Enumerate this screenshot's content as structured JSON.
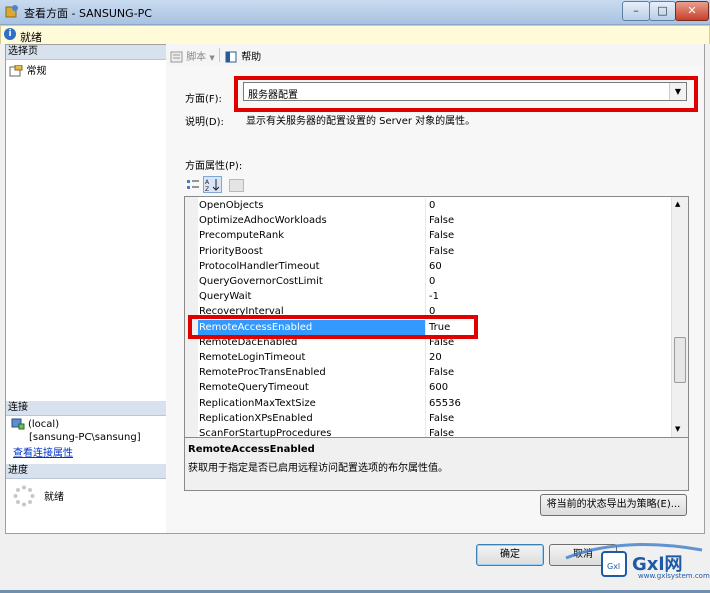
{
  "window": {
    "title": "查看方面 - SANSUNG-PC",
    "min_label": "–",
    "max_label": "□",
    "close_label": "✕"
  },
  "status": {
    "text": "就绪"
  },
  "left": {
    "select_page_label": "选择页",
    "pages": [
      {
        "label": "常规"
      }
    ],
    "connection_header": "连接",
    "server": "(local)",
    "user": "[sansung-PC\\sansung]",
    "view_conn_props": "查看连接属性",
    "progress_header": "进度",
    "progress_status": "就绪"
  },
  "toolbar": {
    "script_label": "脚本",
    "help_label": "帮助"
  },
  "facet": {
    "label": "方面(F):",
    "selected": "服务器配置",
    "desc_label": "说明(D):",
    "desc_text": "显示有关服务器的配置设置的 Server 对象的属性。",
    "props_label": "方面属性(P):"
  },
  "properties": [
    {
      "name": "OpenObjects",
      "value": "0"
    },
    {
      "name": "OptimizeAdhocWorkloads",
      "value": "False"
    },
    {
      "name": "PrecomputeRank",
      "value": "False"
    },
    {
      "name": "PriorityBoost",
      "value": "False"
    },
    {
      "name": "ProtocolHandlerTimeout",
      "value": "60"
    },
    {
      "name": "QueryGovernorCostLimit",
      "value": "0"
    },
    {
      "name": "QueryWait",
      "value": "-1"
    },
    {
      "name": "RecoveryInterval",
      "value": "0"
    },
    {
      "name": "RemoteAccessEnabled",
      "value": "True"
    },
    {
      "name": "RemoteDacEnabled",
      "value": "False"
    },
    {
      "name": "RemoteLoginTimeout",
      "value": "20"
    },
    {
      "name": "RemoteProcTransEnabled",
      "value": "False"
    },
    {
      "name": "RemoteQueryTimeout",
      "value": "600"
    },
    {
      "name": "ReplicationMaxTextSize",
      "value": "65536"
    },
    {
      "name": "ReplicationXPsEnabled",
      "value": "False"
    },
    {
      "name": "ScanForStartupProcedures",
      "value": "False"
    }
  ],
  "description": {
    "title": "RemoteAccessEnabled",
    "text": "获取用于指定是否已启用远程访问配置选项的布尔属性值。"
  },
  "buttons": {
    "export_policy": "将当前的状态导出为策略(E)...",
    "ok": "确定",
    "cancel": "取消"
  },
  "watermark": {
    "brand": "Gxl网",
    "url": "www.gxlsystem.com"
  },
  "colors": {
    "highlight": "#e00000",
    "selection": "#3399ff"
  }
}
